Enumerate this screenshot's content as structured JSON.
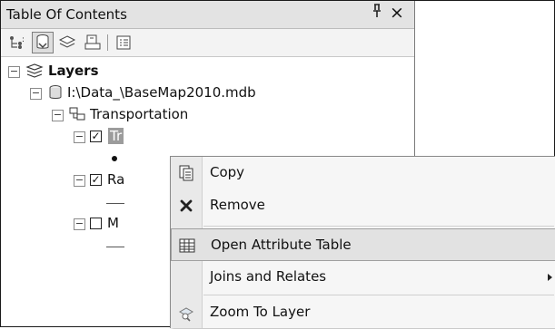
{
  "toc": {
    "title": "Table Of Contents",
    "pin_glyph": "ᚨ",
    "close_glyph": "×"
  },
  "tree": {
    "layers_label": "Layers",
    "database_label": "I:\\Data_\\BaseMap2010.mdb",
    "dataset_label": "Transportation",
    "selected_layer_label": "Tr",
    "layer_ra_label": "Ra",
    "layer_m_label": "M",
    "expander_glyph": "−",
    "check_glyph": "✓"
  },
  "context_menu": {
    "items": [
      {
        "label": "Copy",
        "icon": "copy-icon"
      },
      {
        "label": "Remove",
        "icon": "remove-icon"
      },
      {
        "label": "Open Attribute Table",
        "icon": "table-icon"
      },
      {
        "label": "Joins and Relates",
        "icon": ""
      },
      {
        "label": "Zoom To Layer",
        "icon": "zoom-to-layer-icon"
      }
    ]
  }
}
